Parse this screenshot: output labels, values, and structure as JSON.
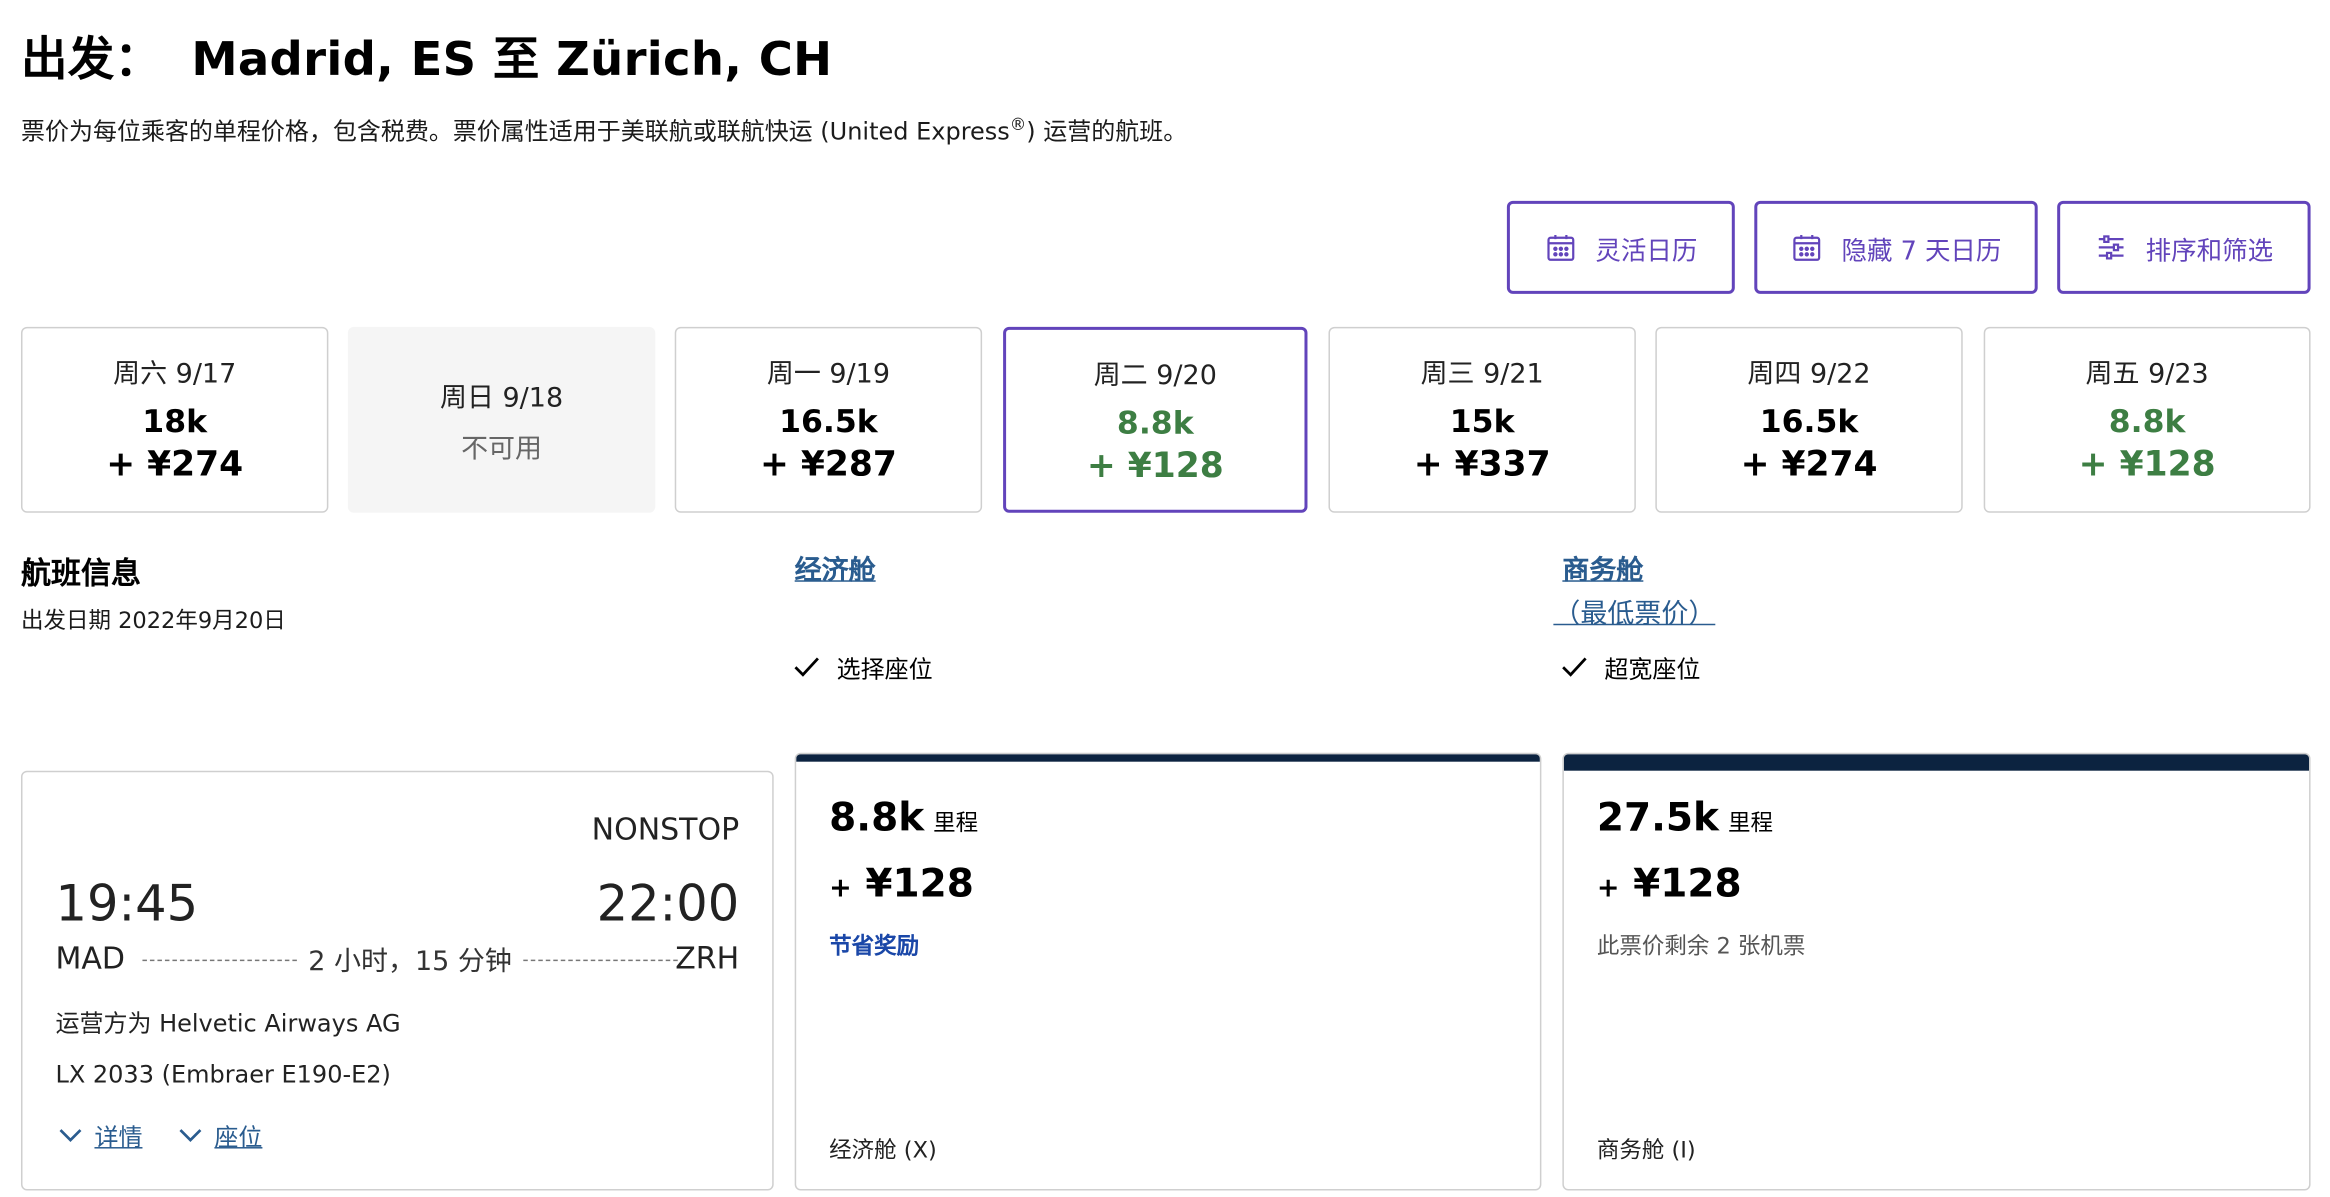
{
  "header": {
    "prefix": "出发：",
    "route": "Madrid, ES 至 Zürich, CH",
    "note_main": "票价为每位乘客的单程价格，包含税费。票价属性适用于美联航或联航快运 (United Express",
    "note_reg": "®",
    "note_end": ") 运营的航班。"
  },
  "actions": [
    {
      "label": "灵活日历",
      "icon": "calendar-icon"
    },
    {
      "label": "隐藏 7 天日历",
      "icon": "calendar-icon"
    },
    {
      "label": "排序和筛选",
      "icon": "sliders-icon"
    }
  ],
  "dates": [
    {
      "label": "周六 9/17",
      "miles": "18k",
      "price": "+ ¥274",
      "state": "normal"
    },
    {
      "label": "周日 9/18",
      "unavailable": "不可用",
      "state": "disabled"
    },
    {
      "label": "周一 9/19",
      "miles": "16.5k",
      "price": "+ ¥287",
      "state": "normal"
    },
    {
      "label": "周二 9/20",
      "miles": "8.8k",
      "price": "+ ¥128",
      "state": "selected"
    },
    {
      "label": "周三 9/21",
      "miles": "15k",
      "price": "+ ¥337",
      "state": "normal"
    },
    {
      "label": "周四 9/22",
      "miles": "16.5k",
      "price": "+ ¥274",
      "state": "normal"
    },
    {
      "label": "周五 9/23",
      "miles": "8.8k",
      "price": "+ ¥128",
      "state": "green"
    }
  ],
  "section": {
    "title": "航班信息",
    "departure_date": "出发日期 2022年9月20日"
  },
  "columns": {
    "economy": {
      "title": "经济舱",
      "feature": "选择座位"
    },
    "business": {
      "title": "商务舱",
      "subtitle": "（最低票价）",
      "feature": "超宽座位"
    }
  },
  "flight": {
    "stops": "NONSTOP",
    "depart_time": "19:45",
    "arrive_time": "22:00",
    "origin": "MAD",
    "destination": "ZRH",
    "duration": "2 小时，15 分钟",
    "operator": "运营方为 Helvetic Airways AG",
    "flight_number": "LX 2033 (Embraer E190-E2)",
    "details_label": "详情",
    "seats_label": "座位"
  },
  "fares": {
    "economy": {
      "miles": "8.8k",
      "miles_unit": "里程",
      "plus": "+",
      "price": "¥128",
      "tag": "节省奖励",
      "class": "经济舱 (X)"
    },
    "business": {
      "miles": "27.5k",
      "miles_unit": "里程",
      "plus": "+",
      "price": "¥128",
      "remaining": "此票价剩余 2 张机票",
      "class": "商务舱 (I)"
    }
  },
  "colors": {
    "accent": "#6244bb",
    "green": "#3d7e43",
    "link": "#2a5c8f",
    "navy": "#0c2340",
    "award_blue": "#1a47a8"
  }
}
